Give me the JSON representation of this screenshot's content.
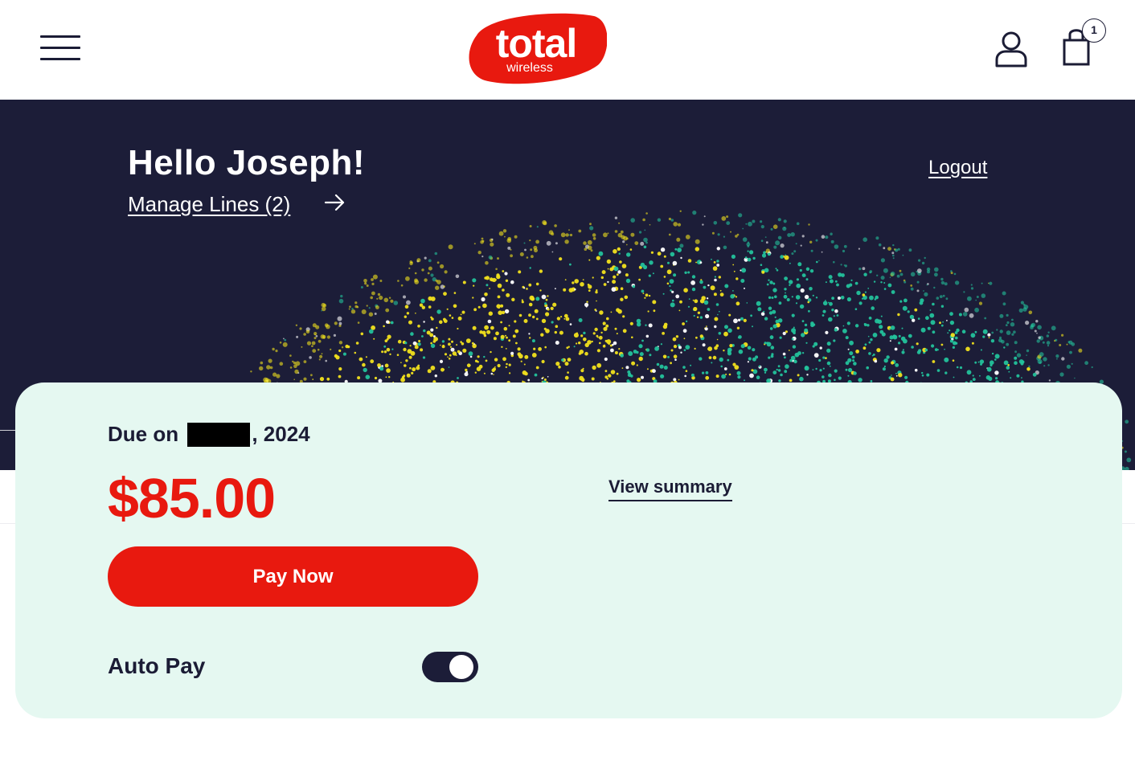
{
  "header": {
    "menu_icon": "hamburger-menu-icon",
    "logo": {
      "main": "total",
      "sub": "wireless",
      "color": "#e8190f"
    },
    "account_icon": "user-icon",
    "cart": {
      "icon": "shopping-bag-icon",
      "count": "1"
    }
  },
  "hero": {
    "greeting": "Hello Joseph!",
    "manage_lines": "Manage Lines (2)",
    "manage_arrow_icon": "arrow-right-icon",
    "logout": "Logout",
    "background": "#1c1d38",
    "splash_colors": [
      "#f2e21c",
      "#23c29b",
      "#ffffff"
    ]
  },
  "bill": {
    "due_prefix": "Due on",
    "due_year": ", 2024",
    "amount": "$85.00",
    "view_summary": "View summary",
    "pay_now": "Pay Now",
    "autopay_label": "Auto Pay",
    "autopay_enabled": true
  },
  "colors": {
    "accent_red": "#e8190f",
    "navy": "#1c1d38",
    "card_bg": "#e5f8f1"
  }
}
